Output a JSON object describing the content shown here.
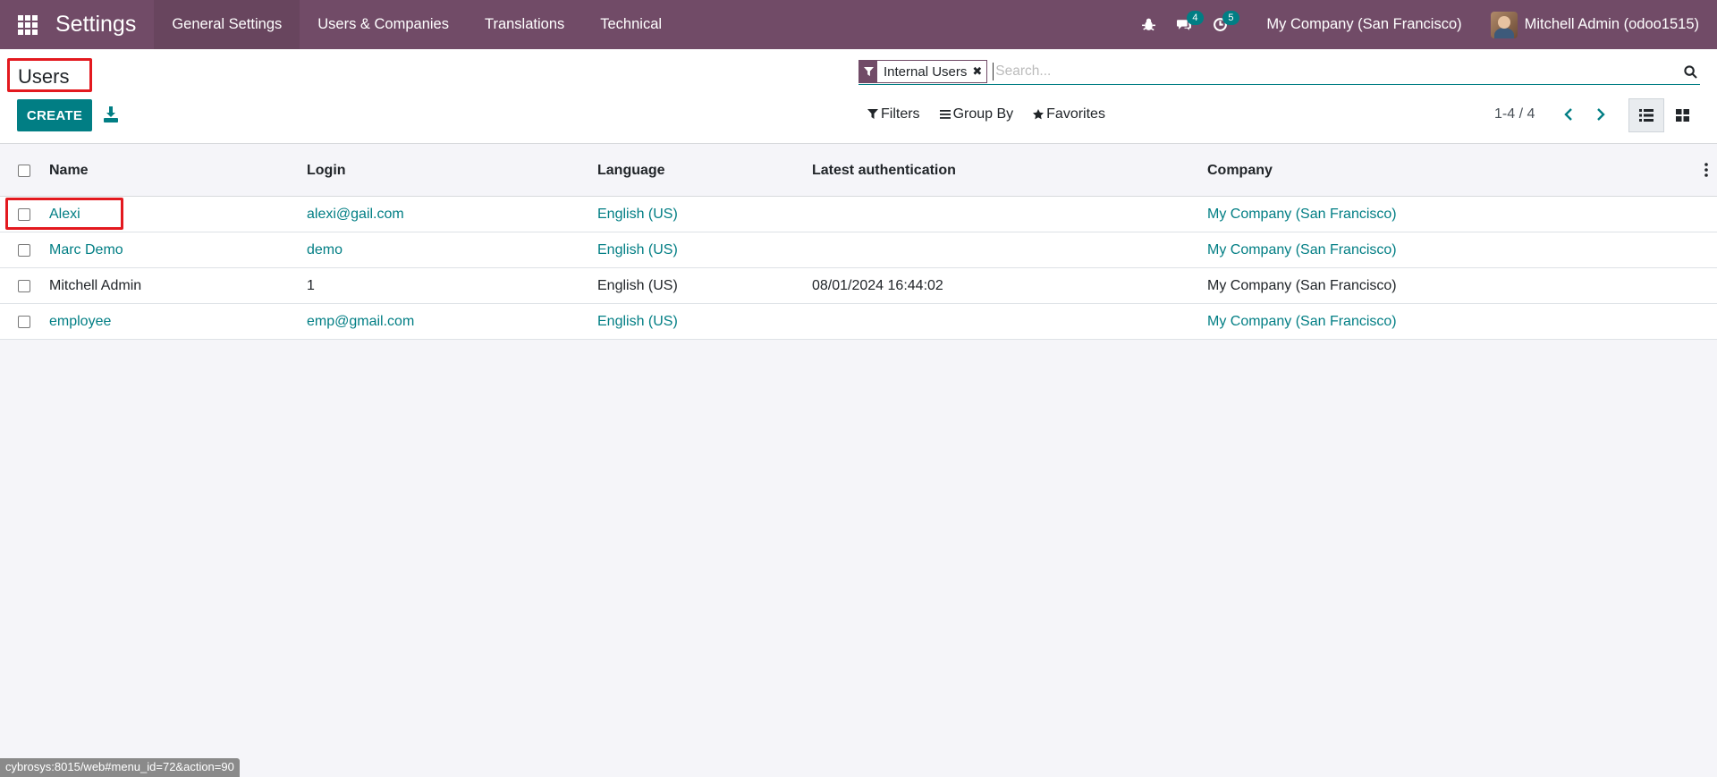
{
  "navbar": {
    "brand": "Settings",
    "menu": [
      "General Settings",
      "Users & Companies",
      "Translations",
      "Technical"
    ],
    "chat_badge": "4",
    "activity_badge": "5",
    "company": "My Company (San Francisco)",
    "user": "Mitchell Admin (odoo1515)"
  },
  "control_panel": {
    "title": "Users",
    "create_label": "CREATE",
    "facet_label": "Internal Users",
    "search_placeholder": "Search...",
    "filters_label": "Filters",
    "groupby_label": "Group By",
    "favorites_label": "Favorites",
    "pager": "1-4 / 4"
  },
  "table": {
    "headers": [
      "Name",
      "Login",
      "Language",
      "Latest authentication",
      "Company"
    ],
    "rows": [
      {
        "name": "Alexi",
        "login": "alexi@gail.com",
        "language": "English (US)",
        "auth": "",
        "company": "My Company (San Francisco)"
      },
      {
        "name": "Marc Demo",
        "login": "demo",
        "language": "English (US)",
        "auth": "",
        "company": "My Company (San Francisco)"
      },
      {
        "name": "Mitchell Admin",
        "login": "1",
        "language": "English (US)",
        "auth": "08/01/2024 16:44:02",
        "company": "My Company (San Francisco)"
      },
      {
        "name": "employee",
        "login": "emp@gmail.com",
        "language": "English (US)",
        "auth": "",
        "company": "My Company (San Francisco)"
      }
    ]
  },
  "status_bar": "cybrosys:8015/web#menu_id=72&action=90",
  "colors": {
    "primary": "#714b67",
    "accent": "#017e84",
    "highlight": "#e3191f"
  }
}
